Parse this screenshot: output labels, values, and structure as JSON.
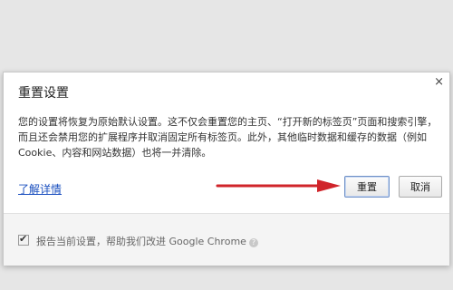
{
  "dialog": {
    "title": "重置设置",
    "close_glyph": "×",
    "description": "您的设置将恢复为原始默认设置。这不仅会重置您的主页、“打开新的标签页”页面和搜索引擎，而且还会禁用您的扩展程序并取消固定所有标签页。此外，其他临时数据和缓存的数据（例如Cookie、内容和网站数据）也将一并清除。",
    "learn_more_label": "了解详情",
    "reset_label": "重置",
    "cancel_label": "取消",
    "report_label": "报告当前设置，帮助我们改进 Google Chrome",
    "report_checked": true,
    "help_glyph": "?"
  },
  "colors": {
    "annotation_arrow": "#d0242a",
    "link": "#1a4fbf"
  },
  "icons": {
    "close": "close-icon",
    "help": "help-icon",
    "check": "check-icon",
    "arrow": "arrow-right-icon"
  }
}
